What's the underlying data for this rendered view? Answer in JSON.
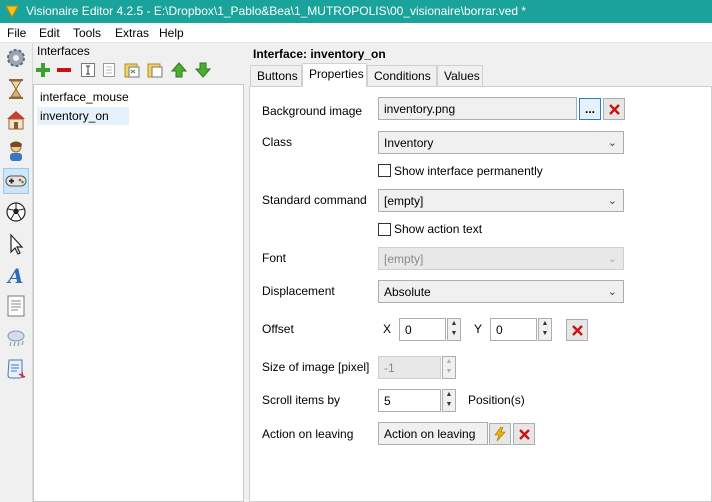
{
  "window": {
    "title": "Visionaire Editor 4.2.5 - E:\\Dropbox\\1_Pablo&Bea\\1_MUTROPOLIS\\00_visionaire\\borrar.ved *"
  },
  "menu": [
    "File",
    "Edit",
    "Tools",
    "Extras",
    "Help"
  ],
  "toolstrip": [
    "gear-icon",
    "hourglass-icon",
    "house-icon",
    "character-icon",
    "gamepad-icon",
    "ball-icon",
    "cursor-icon",
    "font-icon",
    "text-document-icon",
    "cloud-icon",
    "script-icon"
  ],
  "interfaces_panel": {
    "label": "Interfaces",
    "items": [
      "interface_mouse",
      "inventory_on"
    ],
    "selected": "inventory_on"
  },
  "detail": {
    "header": "Interface: inventory_on",
    "tabs": [
      "Buttons",
      "Properties",
      "Conditions",
      "Values"
    ],
    "active_tab": "Properties",
    "properties": {
      "background_image_label": "Background image",
      "background_image_value": "inventory.png",
      "class_label": "Class",
      "class_value": "Inventory",
      "show_permanently_label": "Show interface permanently",
      "standard_command_label": "Standard command",
      "standard_command_value": "[empty]",
      "show_action_text_label": "Show action text",
      "font_label": "Font",
      "font_value": "[empty]",
      "displacement_label": "Displacement",
      "displacement_value": "Absolute",
      "offset_label": "Offset",
      "offset_x_label": "X",
      "offset_x_value": "0",
      "offset_y_label": "Y",
      "offset_y_value": "0",
      "size_label": "Size of image [pixel]",
      "size_value": "-1",
      "scroll_label": "Scroll items by",
      "scroll_value": "5",
      "scroll_unit": "Position(s)",
      "action_leaving_label": "Action on leaving",
      "action_leaving_button": "Action on leaving",
      "browse_label": "..."
    }
  },
  "colors": {
    "titlebar": "#1aa39a",
    "delete_red": "#cc1111",
    "add_green": "#3aa329"
  }
}
